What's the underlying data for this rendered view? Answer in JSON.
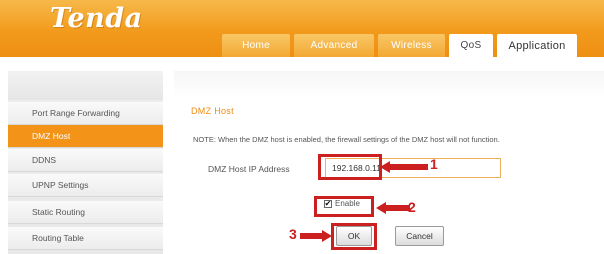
{
  "brand": {
    "logo_text": "Tenda"
  },
  "nav": {
    "tabs": [
      {
        "label": "Home"
      },
      {
        "label": "Advanced"
      },
      {
        "label": "Wireless"
      },
      {
        "label": "QoS"
      },
      {
        "label": "Application"
      }
    ]
  },
  "sidebar": {
    "items": [
      {
        "label": "Port Range Forwarding"
      },
      {
        "label": "DMZ Host"
      },
      {
        "label": "DDNS"
      },
      {
        "label": "UPNP Settings"
      },
      {
        "label": "Static Routing"
      },
      {
        "label": "Routing Table"
      }
    ]
  },
  "main": {
    "section_title": "DMZ Host",
    "note": "NOTE: When the DMZ host is enabled, the firewall settings of the DMZ host will not function.",
    "ip_label": "DMZ Host IP Address",
    "ip_value": "192.168.0.11",
    "enable_label": "Enable",
    "enable_checked": true,
    "ok_label": "OK",
    "cancel_label": "Cancel"
  },
  "annotations": {
    "step1": "1",
    "step2": "2",
    "step3": "3",
    "color": "#cc1f1f"
  },
  "colors": {
    "accent": "#f29a1c",
    "active_sidebar": "#f39318",
    "title": "#ef8b12"
  }
}
